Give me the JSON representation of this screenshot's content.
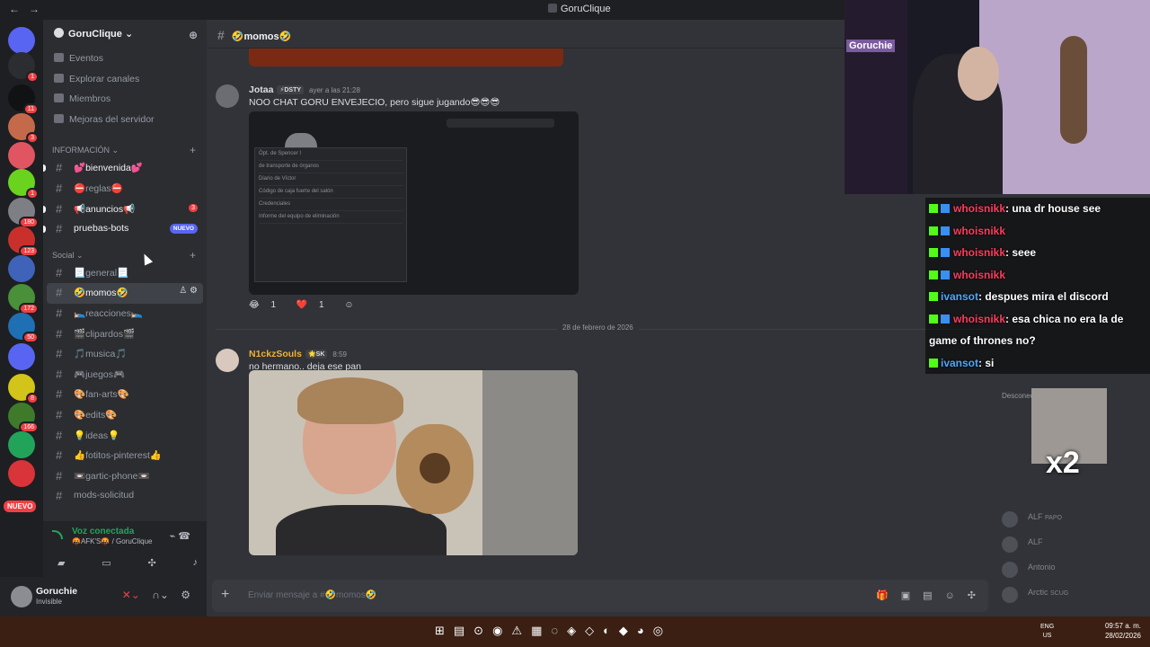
{
  "window": {
    "title": "GoruClique"
  },
  "rail": {
    "servers": [
      {
        "color": "#5865f2",
        "badge": ""
      },
      {
        "color": "#2b2d31",
        "badge": "1"
      },
      {
        "color": "#111214",
        "badge": "11"
      },
      {
        "color": "#c46a4a",
        "badge": "3"
      },
      {
        "color": "#e05561",
        "badge": ""
      },
      {
        "color": "#6ad31e",
        "badge": "1"
      },
      {
        "color": "#7d7f84",
        "badge": "180"
      },
      {
        "color": "#c9302c",
        "badge": "123"
      },
      {
        "color": "#3e63b8",
        "badge": ""
      },
      {
        "color": "#4a8f3a",
        "badge": "172"
      },
      {
        "color": "#1f6fb5",
        "badge": "50"
      },
      {
        "color": "#5865f2",
        "badge": ""
      },
      {
        "color": "#d2c418",
        "badge": "8"
      },
      {
        "color": "#3e7a2a",
        "badge": "166"
      },
      {
        "color": "#22a35a",
        "badge": ""
      },
      {
        "color": "#d8343a",
        "badge": ""
      }
    ],
    "new_label": "NUEVO"
  },
  "sidebar": {
    "server_name": "GoruClique ⌄",
    "menu": [
      "Eventos",
      "Explorar canales",
      "Miembros",
      "Mejoras del servidor"
    ],
    "categories": [
      {
        "name": "INFORMACIÓN ⌄",
        "channels": [
          {
            "label": "💕bienvenida💕",
            "state": "unread",
            "badge": ""
          },
          {
            "label": "⛔reglas⛔",
            "state": "",
            "badge": ""
          },
          {
            "label": "📢anuncios📢",
            "state": "unread",
            "badge": "3"
          },
          {
            "label": "pruebas-bots",
            "state": "unread",
            "badge": "NUEVO"
          }
        ]
      },
      {
        "name": "Social ⌄",
        "channels": [
          {
            "label": "📃general📃",
            "state": "",
            "badge": ""
          },
          {
            "label": "🤣momos🤣",
            "state": "active",
            "badge": ""
          },
          {
            "label": "🛌reacciones🛌",
            "state": "",
            "badge": ""
          },
          {
            "label": "🎬clipardos🎬",
            "state": "",
            "badge": ""
          },
          {
            "label": "🎵musica🎵",
            "state": "",
            "badge": ""
          },
          {
            "label": "🎮juegos🎮",
            "state": "",
            "badge": ""
          },
          {
            "label": "🎨fan-arts🎨",
            "state": "",
            "badge": ""
          },
          {
            "label": "🎨edits🎨",
            "state": "",
            "badge": ""
          },
          {
            "label": "💡ideas💡",
            "state": "",
            "badge": ""
          },
          {
            "label": "👍fotitos-pinterest👍",
            "state": "",
            "badge": ""
          },
          {
            "label": "📼gartic-phone📼",
            "state": "",
            "badge": ""
          },
          {
            "label": "mods-solicitud",
            "state": "",
            "badge": ""
          }
        ]
      }
    ]
  },
  "voice": {
    "status": "Voz conectada",
    "channel": "🤬AFK'S🤬 / GoruClique"
  },
  "user": {
    "name": "Goruchie",
    "status": "Invisible"
  },
  "channel": {
    "name": "🤣momos🤣",
    "placeholder": "Enviar mensaje a #🤣momos🤣"
  },
  "messages": [
    {
      "author": "Jotaa",
      "author_color": "#dbdee1",
      "tag": "⚡DSTY",
      "time": "ayer a las 21:28",
      "text": "NOO CHAT GORU ENVEJECIO, pero sigue jugando😎😎😎",
      "image_rows": [
        "Ópt. de Spencer I",
        "de transporte de órganos",
        "Diario de Víctor",
        "Código de caja fuerte del salón",
        "Credenciales",
        "Informe del equipo de eliminación"
      ],
      "reactions": [
        {
          "emoji": "😂",
          "count": "1"
        },
        {
          "emoji": "❤️",
          "count": "1"
        }
      ]
    },
    {
      "author": "N1ckzSouls",
      "author_color": "#f0b232",
      "tag": "🌟SK",
      "time": "8:59",
      "text": "no hermano.. deja ese pan"
    }
  ],
  "date_divider": "28 de febrero de 2026",
  "members": {
    "section": "Desconectado",
    "items": [
      {
        "name": "ALF",
        "tag": "PAPO"
      },
      {
        "name": "ALF",
        "tag": ""
      },
      {
        "name": "Antonio",
        "tag": ""
      },
      {
        "name": "Arctic",
        "tag": "SCUG"
      }
    ]
  },
  "overlay_chat": [
    {
      "user": "whoisnikk",
      "msg": ": una dr house see",
      "color": "u1"
    },
    {
      "user": "whoisnikk",
      "msg": "",
      "color": "u1"
    },
    {
      "user": "whoisnikk",
      "msg": ": seee",
      "color": "u1"
    },
    {
      "user": "whoisnikk",
      "msg": "",
      "color": "u1"
    },
    {
      "user": "ivansot",
      "msg": ": despues mira el discord",
      "color": "u2"
    },
    {
      "user": "whoisnikk",
      "msg": ": esa chica no era la de game of thrones no?",
      "color": "u1"
    },
    {
      "user": "ivansot",
      "msg": ": si",
      "color": "u2"
    }
  ],
  "overlay_x2": "x2",
  "cam_logo": "Goruchie",
  "taskbar": {
    "lang": "ENG",
    "region": "US",
    "time": "09:57 a. m.",
    "date": "28/02/2026"
  }
}
